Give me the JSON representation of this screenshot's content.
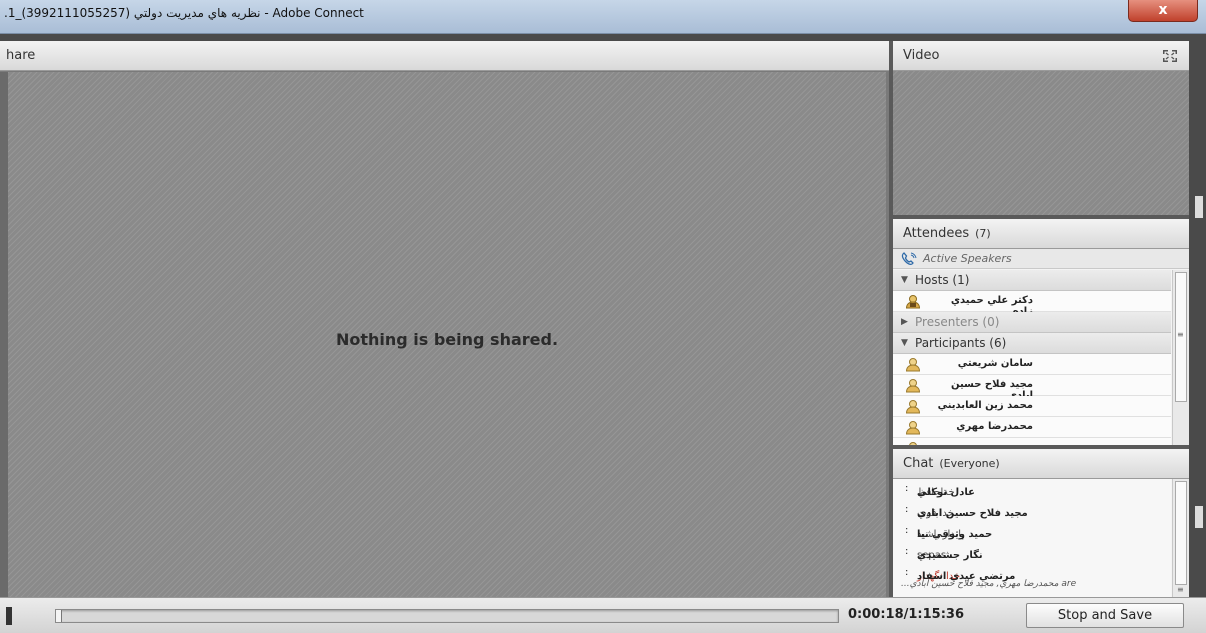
{
  "window": {
    "title": ".1_(3992111055257) نظريه هاي مديريت دولتي - Adobe Connect",
    "close_label": "x"
  },
  "share_pod": {
    "title": "hare",
    "empty_message": "Nothing is being shared."
  },
  "video_pod": {
    "title": "Video",
    "icons": {
      "fullscreen": "fullscreen-icon"
    }
  },
  "attendees_pod": {
    "title": "Attendees",
    "count": "(7)",
    "active_speakers": "Active Speakers",
    "sections": [
      {
        "label": "Hosts (1)",
        "expanded": true,
        "people": [
          "دكتر علي حميدي زاده"
        ]
      },
      {
        "label": "Presenters (0)",
        "expanded": false,
        "people": []
      },
      {
        "label": "Participants (6)",
        "expanded": true,
        "people": [
          "سامان شريعتي",
          "مجيد فلاح حسين ابادي",
          "محمد زين العابديني",
          "محمدرضا مهري"
        ]
      }
    ],
    "colors": {
      "host_icon": "#c99a2e",
      "participant_icon": "#d9a94a"
    }
  },
  "chat_pod": {
    "title": "Chat",
    "scope": "(Everyone)",
    "messages": [
      {
        "sender": "عادل توكلي",
        "text": "خداحافظ"
      },
      {
        "sender": "مجيد فلاح حسين ابادي",
        "text": "خدا قوت"
      },
      {
        "sender": "حميد وثوقي نيا",
        "text": "پايدار باشيد"
      },
      {
        "sender": "نگار جشميدي",
        "text": "sepas"
      },
      {
        "sender": "مرتضي عيدي اسفاد",
        "text": "خدا نگهدار",
        "highlight": true
      }
    ],
    "typing": "...محمدرضا مهري, مجيد فلاح حسين ابادي are"
  },
  "playback": {
    "time": "0:00:18/1:15:36",
    "progress": 0.004,
    "stop_label": "Stop and Save"
  }
}
